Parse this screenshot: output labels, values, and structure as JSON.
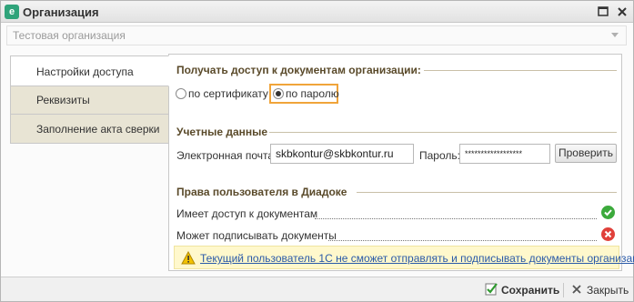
{
  "window": {
    "title": "Организация",
    "app_icon_glyph": "e"
  },
  "org_select": {
    "value": "Тестовая организация"
  },
  "tabs": [
    {
      "label": "Настройки доступа",
      "active": true
    },
    {
      "label": "Реквизиты",
      "active": false
    },
    {
      "label": "Заполнение акта сверки",
      "active": false
    }
  ],
  "access": {
    "title": "Получать доступ к документам организации:",
    "option_certificate": "по сертификату",
    "option_password": "по паролю",
    "selected": "password"
  },
  "credentials": {
    "title": "Учетные данные",
    "email_label": "Электронная почта:",
    "email_value": "skbkontur@skbkontur.ru",
    "password_label": "Пароль:",
    "password_value": "******************",
    "check_button": "Проверить"
  },
  "rights": {
    "title": "Права пользователя в Диадоке",
    "items": [
      {
        "label": "Имеет доступ к документам",
        "status": "ok"
      },
      {
        "label": "Может подписывать документы",
        "status": "no"
      }
    ]
  },
  "warning": {
    "text": "Текущий пользователь 1С не сможет отправлять и подписывать документы организации."
  },
  "footer": {
    "save_label": "Сохранить",
    "close_label": "Закрыть"
  },
  "colors": {
    "accent_highlight": "#f0a43a",
    "ok": "#3caa3c",
    "error": "#e0403a",
    "link": "#2a5aa8",
    "section_title": "#5a4a2a"
  }
}
